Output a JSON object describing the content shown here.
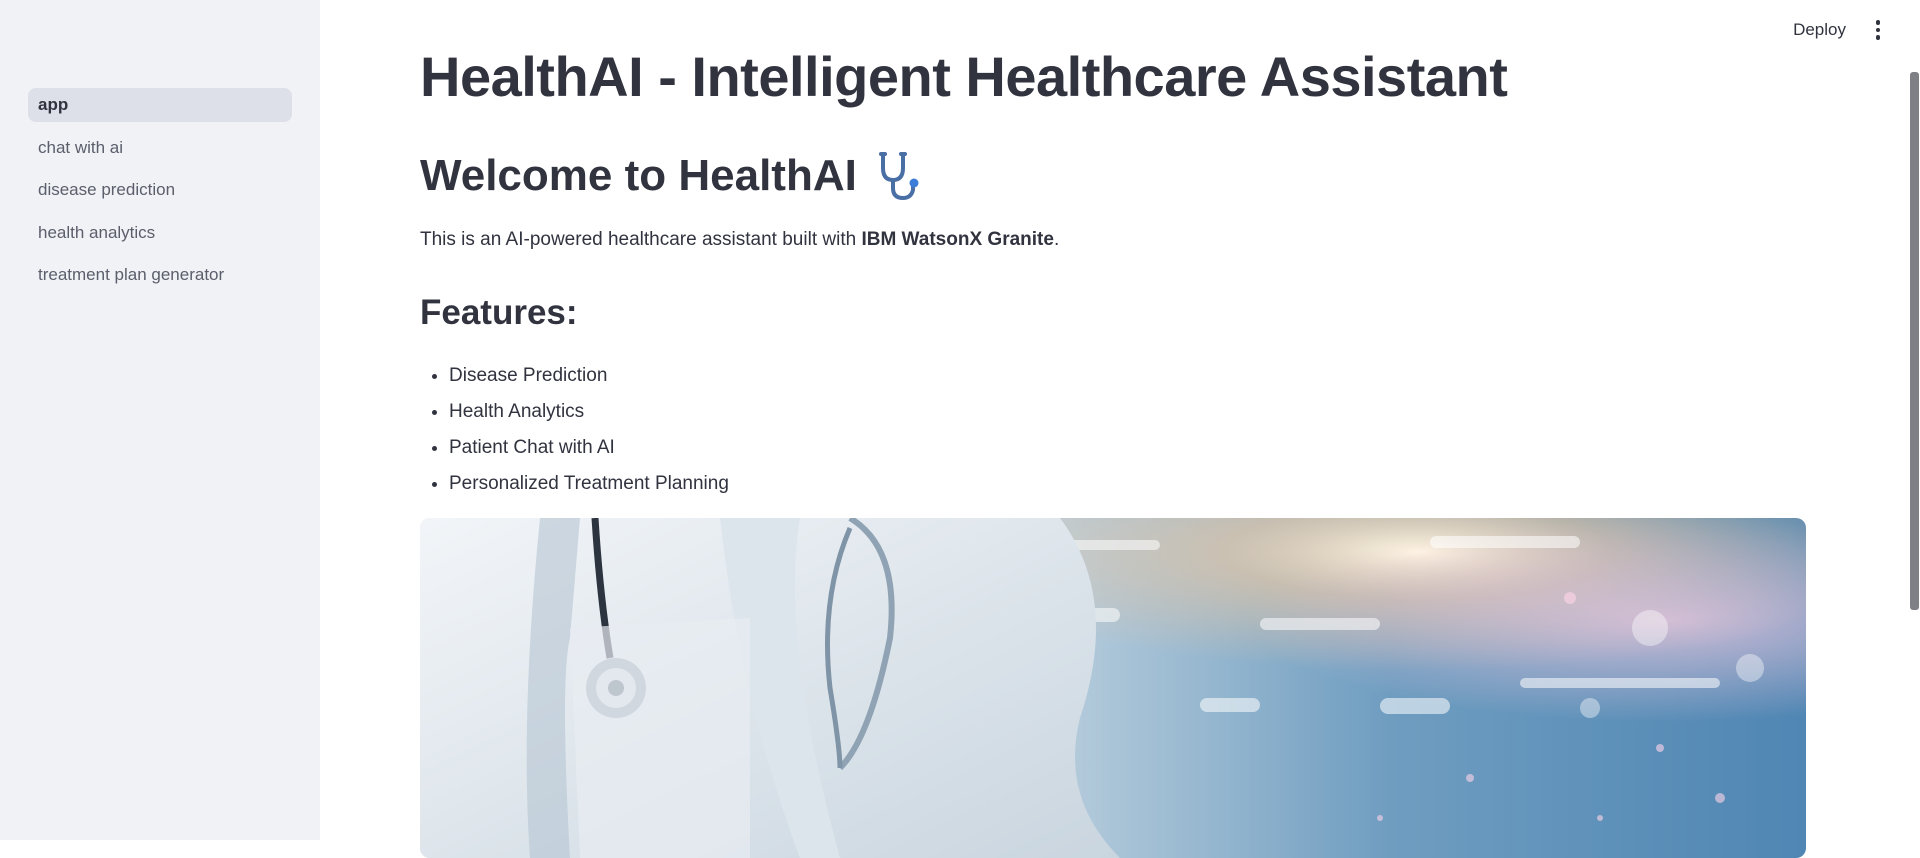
{
  "sidebar": {
    "items": [
      {
        "label": "app",
        "active": true
      },
      {
        "label": "chat with ai"
      },
      {
        "label": "disease prediction"
      },
      {
        "label": "health analytics"
      },
      {
        "label": "treatment plan generator"
      }
    ]
  },
  "header": {
    "deploy_label": "Deploy",
    "menu_icon": "kebab-menu-icon"
  },
  "main": {
    "title": "HealthAI - Intelligent Healthcare Assistant",
    "welcome_heading": "Welcome to HealthAI",
    "welcome_icon": "stethoscope-icon",
    "intro_prefix": "This is an AI-powered healthcare assistant built with ",
    "intro_bold": "IBM WatsonX Granite",
    "intro_suffix": ".",
    "features_heading": "Features:",
    "features": [
      "Disease Prediction",
      "Health Analytics",
      "Patient Chat with AI",
      "Personalized Treatment Planning"
    ],
    "hero_image": "doctor-with-stethoscope-image"
  },
  "colors": {
    "sidebar_bg": "#f0f2f6",
    "active_item_bg": "#dde0e8",
    "text": "#31333f",
    "accent": "#3b7dd8"
  }
}
